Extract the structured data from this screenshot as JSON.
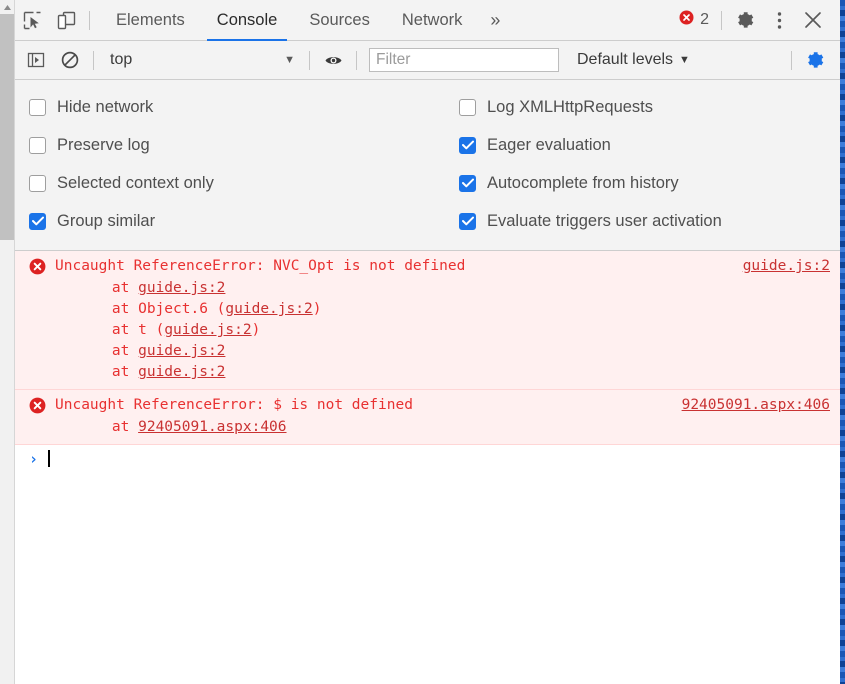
{
  "window": {
    "title": "Chrome DevTools - Console"
  },
  "tabbar": {
    "inspect_icon": "inspect-element-icon",
    "device_icon": "device-toolbar-icon",
    "tabs": [
      {
        "label": "Elements",
        "active": false
      },
      {
        "label": "Console",
        "active": true
      },
      {
        "label": "Sources",
        "active": false
      },
      {
        "label": "Network",
        "active": false
      }
    ],
    "more_tabs_label": "»",
    "error_count": "2",
    "error_icon": "error-circle-icon",
    "settings_icon": "gear-icon",
    "more_options_icon": "kebab-menu-icon",
    "close_icon": "close-icon"
  },
  "filterbar": {
    "sidebar_icon": "console-sidebar-icon",
    "clear_icon": "clear-console-icon",
    "context_value": "top",
    "context_caret": "▼",
    "live_expression_icon": "eye-icon",
    "filter_placeholder": "Filter",
    "filter_value": "",
    "levels_label": "Default levels",
    "levels_caret": "▼",
    "settings_icon": "gear-icon-active"
  },
  "settings": {
    "left": [
      {
        "label": "Hide network",
        "checked": false
      },
      {
        "label": "Preserve log",
        "checked": false
      },
      {
        "label": "Selected context only",
        "checked": false
      },
      {
        "label": "Group similar",
        "checked": true
      }
    ],
    "right": [
      {
        "label": "Log XMLHttpRequests",
        "checked": false
      },
      {
        "label": "Eager evaluation",
        "checked": true
      },
      {
        "label": "Autocomplete from history",
        "checked": true
      },
      {
        "label": "Evaluate triggers user activation",
        "checked": true
      }
    ]
  },
  "console": {
    "messages": [
      {
        "level": "error",
        "icon": "error-circle-icon",
        "text": "Uncaught ReferenceError: NVC_Opt is not defined",
        "source": "guide.js:2",
        "stack": [
          {
            "prefix": "    at ",
            "link": "guide.js:2",
            "suffix": ""
          },
          {
            "prefix": "    at Object.6 (",
            "link": "guide.js:2",
            "suffix": ")"
          },
          {
            "prefix": "    at t (",
            "link": "guide.js:2",
            "suffix": ")"
          },
          {
            "prefix": "    at ",
            "link": "guide.js:2",
            "suffix": ""
          },
          {
            "prefix": "    at ",
            "link": "guide.js:2",
            "suffix": ""
          }
        ]
      },
      {
        "level": "error",
        "icon": "error-circle-icon",
        "text": "Uncaught ReferenceError: $ is not defined",
        "source": "92405091.aspx:406",
        "stack": [
          {
            "prefix": "    at ",
            "link": "92405091.aspx:406",
            "suffix": ""
          }
        ]
      }
    ],
    "prompt_arrow": "›",
    "prompt_value": ""
  },
  "colors": {
    "accent": "#1a73e8",
    "error_text": "#e83131",
    "error_bg": "#fff0f0",
    "toolbar_bg": "#f3f3f3",
    "border": "#cdcdcd"
  },
  "scrollbar": {
    "up_arrow_icon": "scroll-up-arrow-icon",
    "thumb": "scrollbar-thumb"
  }
}
